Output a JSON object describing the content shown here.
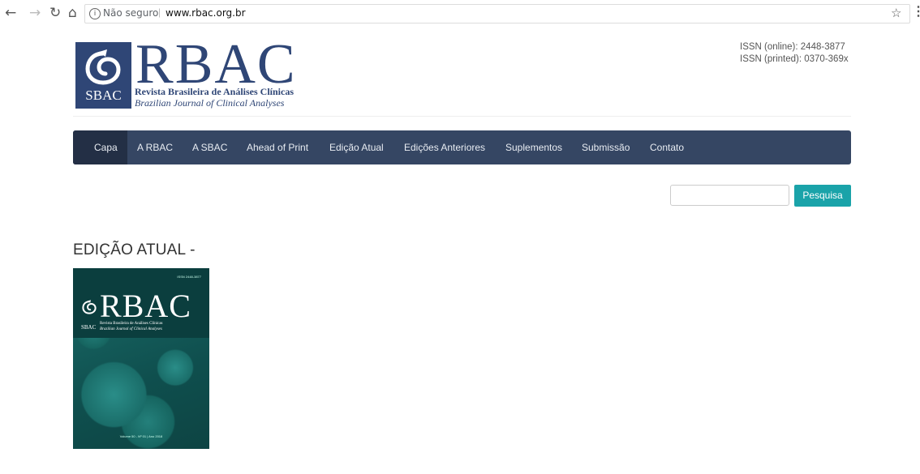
{
  "browser": {
    "back_icon": "arrow-left-icon",
    "forward_icon": "arrow-right-icon",
    "reload_icon": "reload-icon",
    "home_icon": "home-icon",
    "security_label": "Não seguro",
    "url": "www.rbac.org.br",
    "bookmark_icon": "star-icon",
    "menu_icon": "kebab-menu-icon"
  },
  "header": {
    "logo": {
      "box_label": "SBAC",
      "title": "RBAC",
      "subtitle_pt": "Revista Brasileira de Análises Clínicas",
      "subtitle_en": "Brazilian Journal of Clinical Analyses"
    },
    "issn_online": "ISSN (online): 2448-3877",
    "issn_printed": "ISSN (printed): 0370-369x"
  },
  "nav": {
    "items": [
      {
        "label": "Capa",
        "active": true
      },
      {
        "label": "A RBAC"
      },
      {
        "label": "A SBAC"
      },
      {
        "label": "Ahead of Print"
      },
      {
        "label": "Edição Atual"
      },
      {
        "label": "Edições Anteriores"
      },
      {
        "label": "Suplementos"
      },
      {
        "label": "Submissão"
      },
      {
        "label": "Contato"
      }
    ]
  },
  "search": {
    "value": "",
    "button_label": "Pesquisa"
  },
  "main": {
    "heading": "EDIÇÃO ATUAL -",
    "cover": {
      "issn": "ISSN 2448-3877",
      "label": "SBAC",
      "title": "RBAC",
      "subtitle_pt": "Revista Brasileira de Análises Clínicas",
      "subtitle_en": "Brazilian Journal of Clinical Analyses",
      "footer": "Volume 50 - Nº 01 | Ano 2018"
    }
  },
  "colors": {
    "brand": "#2f4676",
    "nav_bg": "#354663",
    "nav_active": "#232f45",
    "button": "#1aa3a9",
    "cover": "#166560"
  }
}
